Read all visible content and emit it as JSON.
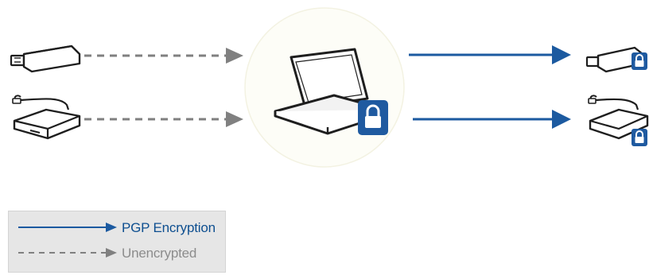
{
  "legend": {
    "pgp_label": "PGP Encryption",
    "unencrypted_label": "Unencrypted"
  },
  "colors": {
    "pgp_line": "#1c5aa0",
    "unencrypted_line": "#808080",
    "lock_fill": "#1f5aa0",
    "device_stroke": "#1e1e1e",
    "legend_background": "#e6e6e6"
  },
  "icons": [
    "usb-drive-icon",
    "external-hard-drive-icon",
    "laptop-icon",
    "padlock-icon"
  ]
}
